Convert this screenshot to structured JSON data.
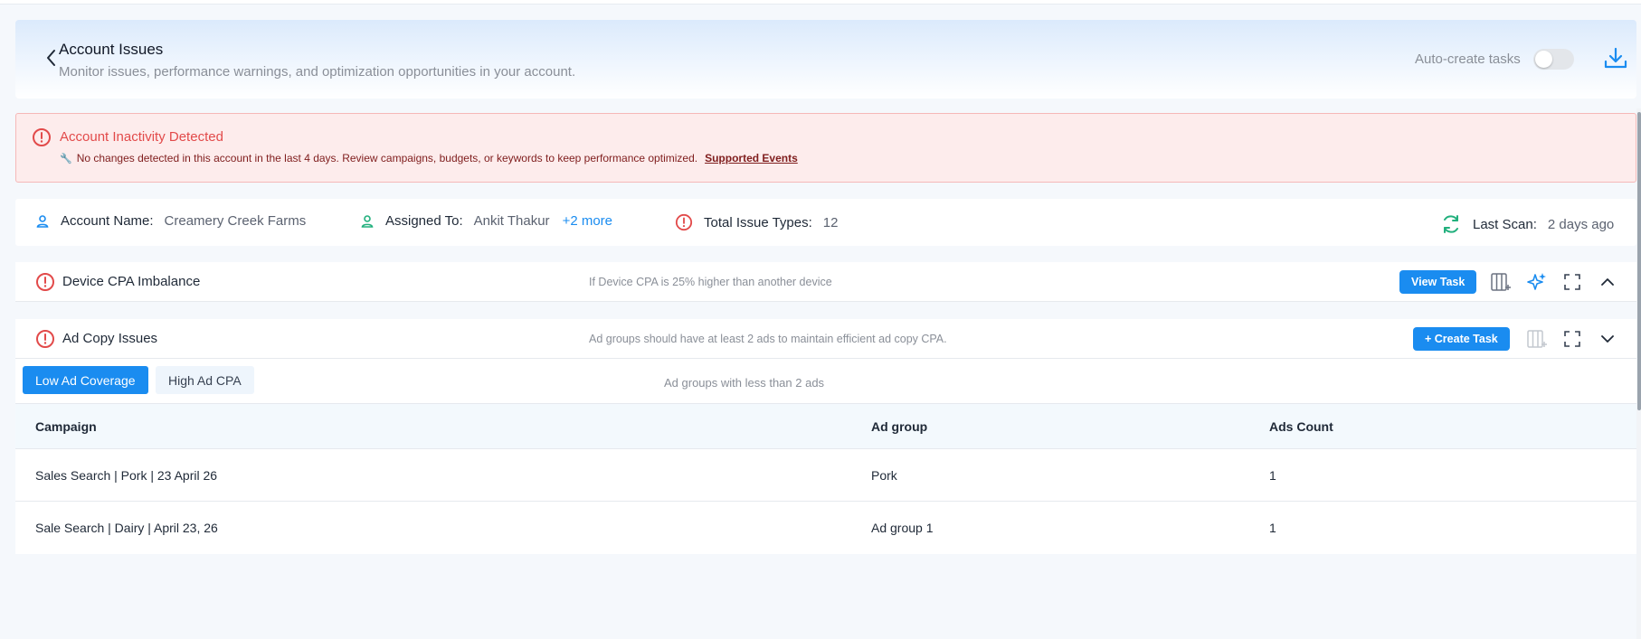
{
  "header": {
    "title": "Account Issues",
    "subtitle": "Monitor issues, performance warnings, and optimization opportunities in your account.",
    "auto_create_label": "Auto-create tasks",
    "auto_create_enabled": false
  },
  "alert": {
    "title": "Account Inactivity Detected",
    "message": "No changes detected in this account in the last 4 days. Review campaigns, budgets, or keywords to keep performance optimized.",
    "link_label": "Supported Events"
  },
  "info": {
    "account_name_label": "Account Name:",
    "account_name_value": "Creamery Creek Farms",
    "assigned_label": "Assigned To:",
    "assigned_value": "Ankit Thakur",
    "assigned_more": "+2 more",
    "issue_types_label": "Total Issue Types:",
    "issue_types_value": "12",
    "last_scan_label": "Last Scan:",
    "last_scan_value": "2 days ago"
  },
  "issues": [
    {
      "title": "Device CPA Imbalance",
      "description": "If Device CPA is 25% higher than another device",
      "action_label": "View Task"
    },
    {
      "title": "Ad Copy Issues",
      "description": "Ad groups should have at least 2 ads to maintain efficient ad copy CPA.",
      "action_label": "+ Create Task"
    }
  ],
  "expanded": {
    "tabs": [
      {
        "label": "Low Ad Coverage",
        "active": true
      },
      {
        "label": "High Ad CPA",
        "active": false
      }
    ],
    "tab_description": "Ad groups with less than 2 ads",
    "columns": [
      "Campaign",
      "Ad group",
      "Ads Count"
    ],
    "rows": [
      {
        "campaign": "Sales Search | Pork | 23 April 26",
        "ad_group": "Pork",
        "ads_count": "1"
      },
      {
        "campaign": "Sale Search | Dairy | April 23, 26",
        "ad_group": "Ad group 1",
        "ads_count": "1"
      }
    ]
  },
  "colors": {
    "accent": "#1a8cf0",
    "danger": "#e24a4a",
    "success": "#22b07d"
  },
  "icons": [
    "chevron-left-icon",
    "download-icon",
    "alert-circle-icon",
    "user-icon",
    "refresh-icon",
    "columns-icon",
    "sparkle-icon",
    "fullscreen-icon",
    "chevron-up-icon",
    "chevron-down-icon",
    "wrench-icon"
  ]
}
